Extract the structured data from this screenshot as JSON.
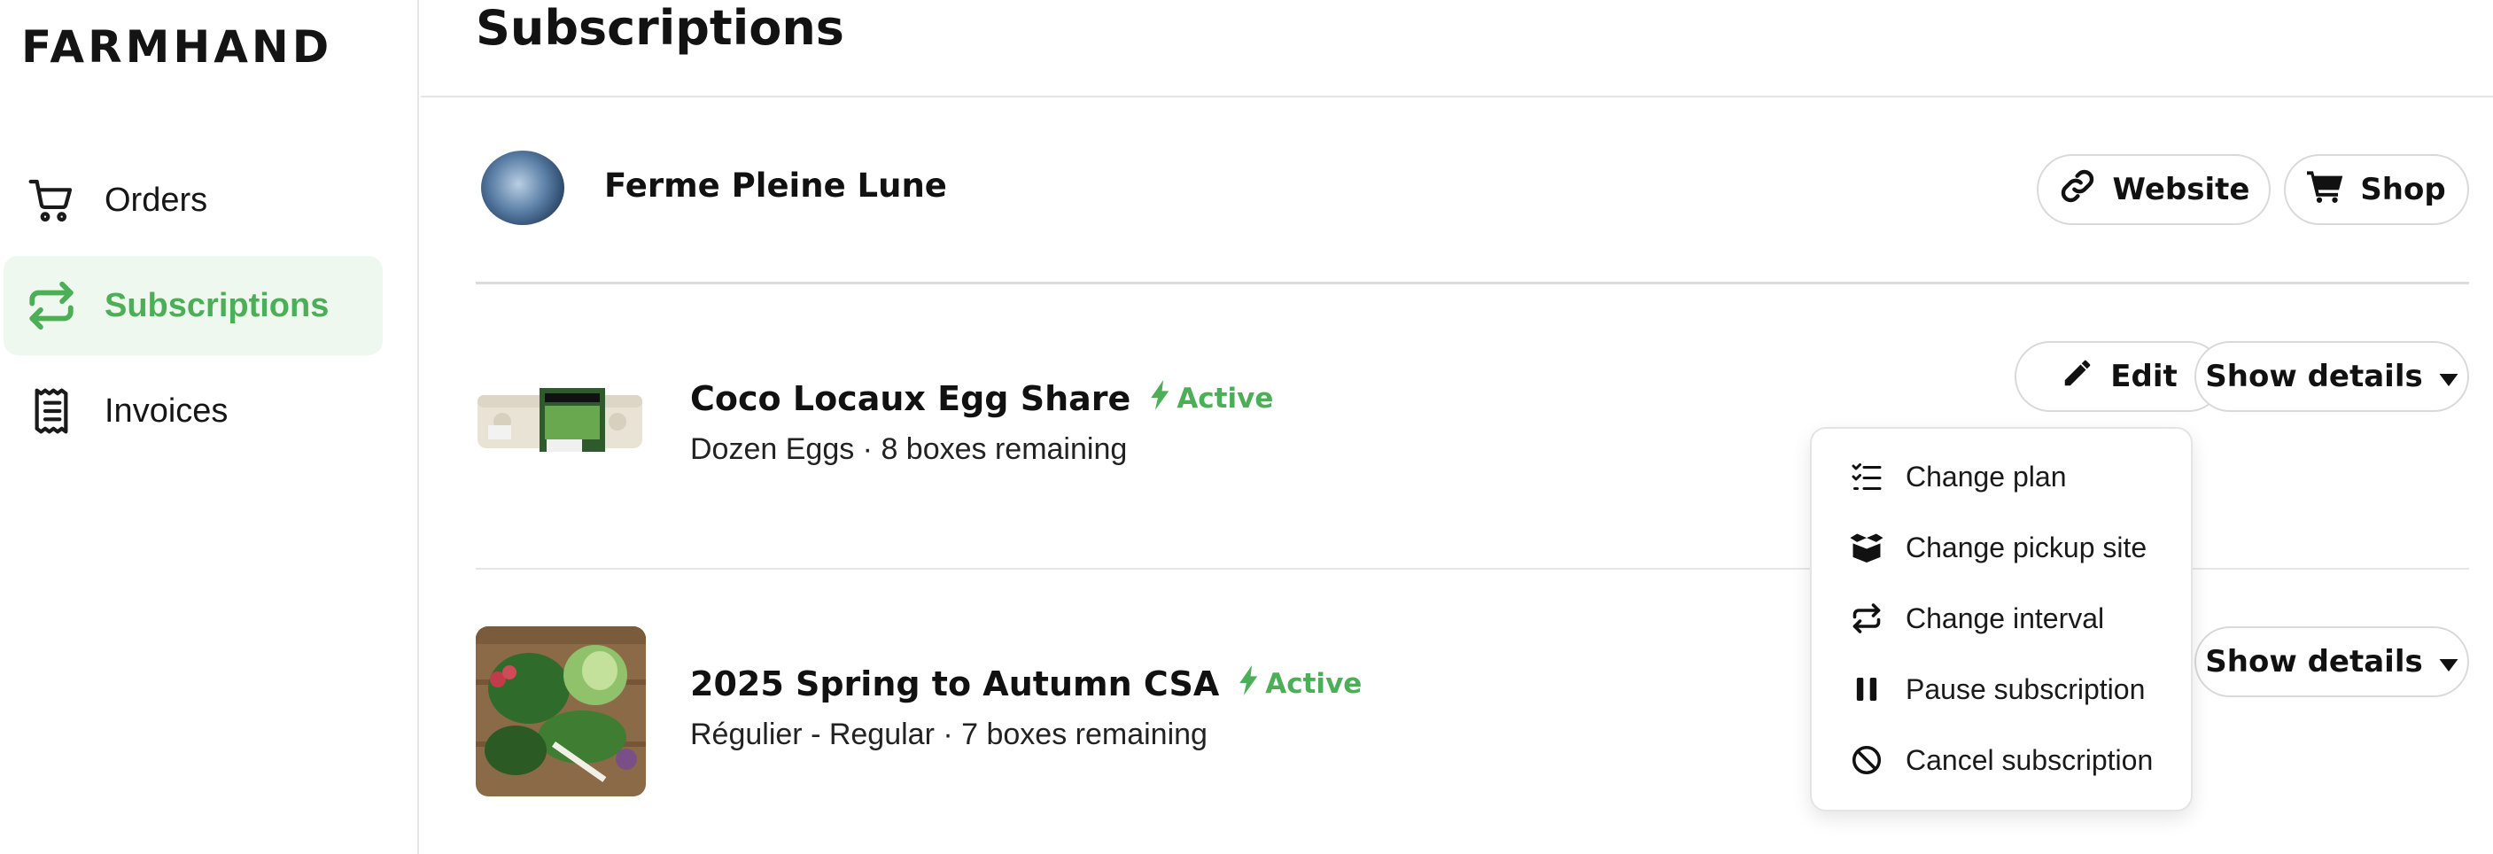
{
  "brand": {
    "logo_text": "FARMHAND"
  },
  "sidebar": {
    "items": [
      {
        "label": "Orders",
        "icon": "cart-icon"
      },
      {
        "label": "Subscriptions",
        "icon": "repeat-icon",
        "active": true
      },
      {
        "label": "Invoices",
        "icon": "receipt-icon"
      }
    ]
  },
  "page": {
    "title": "Subscriptions"
  },
  "farm": {
    "name": "Ferme Pleine Lune",
    "website_label": "Website",
    "shop_label": "Shop"
  },
  "subscriptions": [
    {
      "title": "Coco Locaux Egg Share",
      "status": "Active",
      "subtitle": "Dozen Eggs · 8 boxes remaining",
      "edit_label": "Edit",
      "details_label": "Show details"
    },
    {
      "title": "2025 Spring to Autumn CSA",
      "status": "Active",
      "subtitle": "Régulier - Regular · 7 boxes remaining",
      "details_label": "Show details"
    }
  ],
  "dropdown": {
    "items": [
      {
        "label": "Change plan",
        "icon": "checklist-icon"
      },
      {
        "label": "Change pickup site",
        "icon": "box-icon"
      },
      {
        "label": "Change interval",
        "icon": "repeat-icon"
      },
      {
        "label": "Pause subscription",
        "icon": "pause-icon"
      },
      {
        "label": "Cancel subscription",
        "icon": "ban-icon"
      }
    ]
  },
  "colors": {
    "accent": "#4caf58",
    "active_nav_bg": "#eef8ef",
    "border": "#d9d9d9"
  }
}
